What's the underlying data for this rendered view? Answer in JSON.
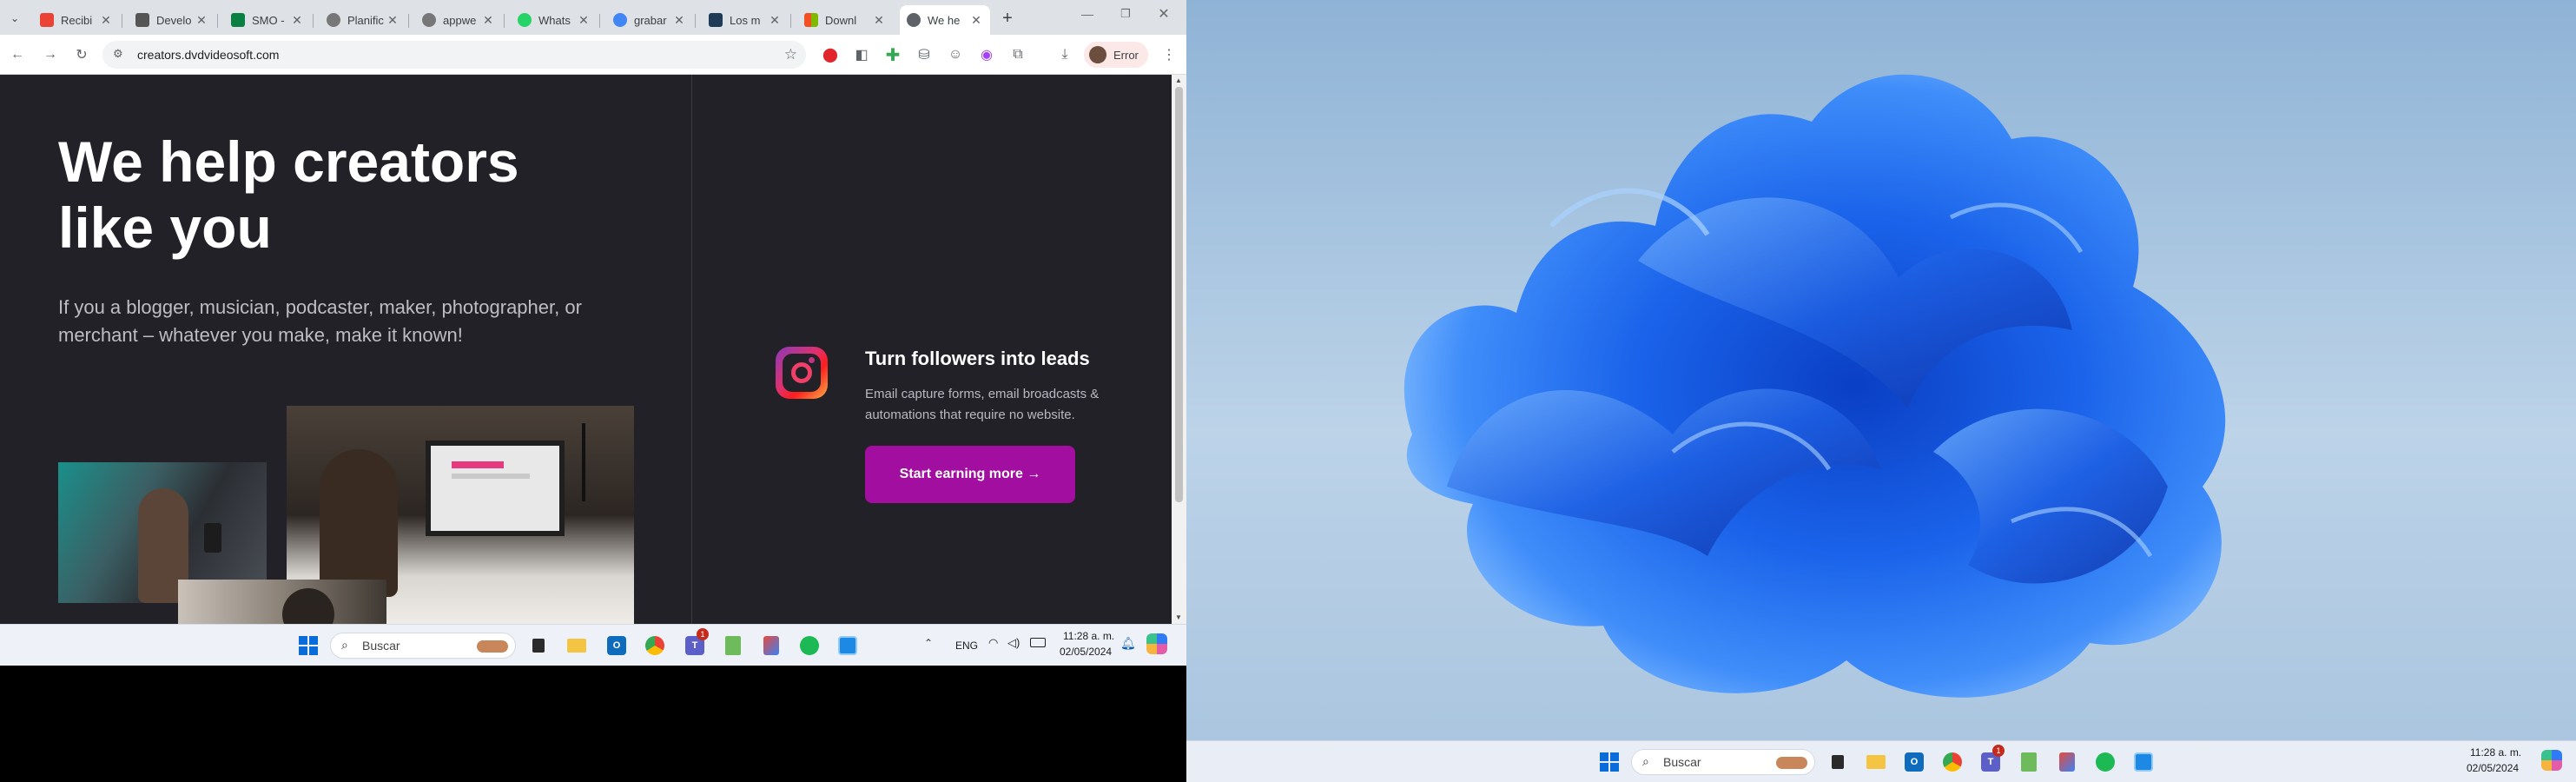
{
  "browser": {
    "tabs": [
      {
        "title": "Recibi",
        "favicon_color": "#ea4335"
      },
      {
        "title": "Develo",
        "favicon_color": "#555555"
      },
      {
        "title": "SMO -",
        "favicon_color": "#0b8043"
      },
      {
        "title": "Planific",
        "favicon_color": "#777777"
      },
      {
        "title": "appwe",
        "favicon_color": "#777777"
      },
      {
        "title": "Whats",
        "favicon_color": "#25d366"
      },
      {
        "title": "grabar",
        "favicon_color": "#4285f4"
      },
      {
        "title": "Los m",
        "favicon_color": "#1f3b55"
      },
      {
        "title": "Downl",
        "favicon_color": "#f25022"
      },
      {
        "title": "We he",
        "favicon_color": "#5f6368"
      }
    ],
    "active_tab_index": 9,
    "url": "creators.dvdvideosoft.com",
    "profile_label": "Error",
    "new_tab_icon": "plus-icon"
  },
  "page": {
    "hero_title": "We help creators like you",
    "hero_subtitle": "If you a blogger, musician, podcaster, maker, photographer, or merchant – whatever you make, make it known!",
    "feature_title": "Turn followers into leads",
    "feature_desc": "Email capture forms, email broadcasts & automations that require no website.",
    "cta_label": "Start earning more →",
    "accent_color": "#a20fa0"
  },
  "taskbar_left": {
    "search_placeholder": "Buscar",
    "language": "ENG",
    "time": "11:28 a. m.",
    "date": "02/05/2024",
    "teams_badge": "1"
  },
  "taskbar_right": {
    "search_placeholder": "Buscar",
    "time": "11:28 a. m.",
    "date": "02/05/2024",
    "teams_badge": "1"
  }
}
